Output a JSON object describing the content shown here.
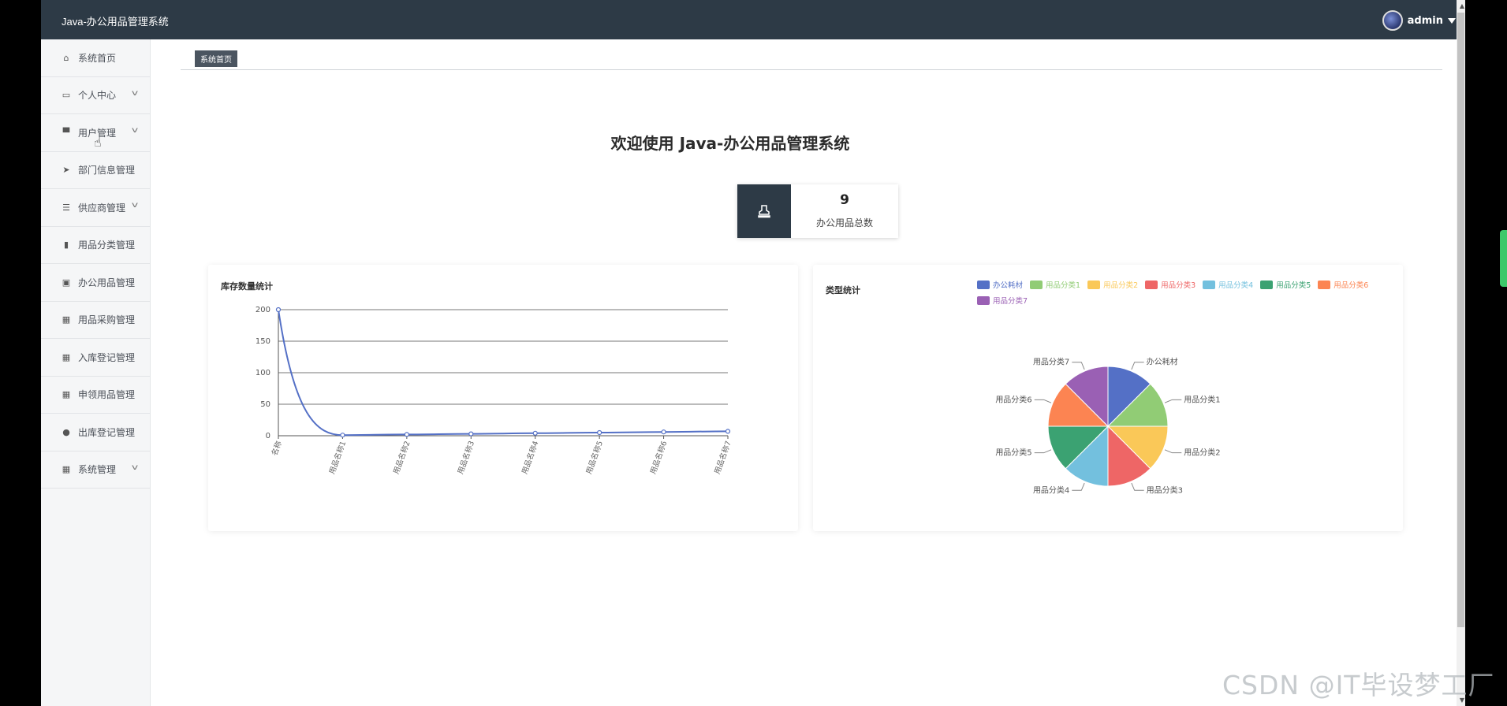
{
  "header": {
    "app_title": "Java-办公用品管理系统",
    "username": "admin"
  },
  "sidebar": {
    "items": [
      {
        "label": "系统首页",
        "icon": "home-icon",
        "has_submenu": false
      },
      {
        "label": "个人中心",
        "icon": "calendar-icon",
        "has_submenu": true
      },
      {
        "label": "用户管理",
        "icon": "user-icon",
        "has_submenu": true
      },
      {
        "label": "部门信息管理",
        "icon": "send-icon",
        "has_submenu": false
      },
      {
        "label": "供应商管理",
        "icon": "sliders-icon",
        "has_submenu": true
      },
      {
        "label": "用品分类管理",
        "icon": "bar-chart-icon",
        "has_submenu": false
      },
      {
        "label": "办公用品管理",
        "icon": "clipboard-icon",
        "has_submenu": false
      },
      {
        "label": "用品采购管理",
        "icon": "grid-icon",
        "has_submenu": false
      },
      {
        "label": "入库登记管理",
        "icon": "grid-icon",
        "has_submenu": false
      },
      {
        "label": "申领用品管理",
        "icon": "grid-icon",
        "has_submenu": false
      },
      {
        "label": "出库登记管理",
        "icon": "location-icon",
        "has_submenu": false
      },
      {
        "label": "系统管理",
        "icon": "grid-icon",
        "has_submenu": true
      }
    ]
  },
  "breadcrumb": {
    "current": "系统首页"
  },
  "welcome": "欢迎使用 Java-办公用品管理系统",
  "stat": {
    "value": "9",
    "label": "办公用品总数",
    "icon": "stamp-icon"
  },
  "colors": {
    "topbar": "#2d3a46",
    "line": "#5470c6"
  },
  "chart_data": [
    {
      "type": "line",
      "title": "库存数量统计",
      "categories": [
        "名称",
        "用品名称1",
        "用品名称2",
        "用品名称3",
        "用品名称4",
        "用品名称5",
        "用品名称6",
        "用品名称7"
      ],
      "values": [
        200,
        1,
        2,
        3,
        4,
        5,
        6,
        7
      ],
      "ylim": [
        0,
        200
      ],
      "yticks": [
        0,
        50,
        100,
        150,
        200
      ],
      "smooth": true,
      "grid": "horizontal"
    },
    {
      "type": "pie",
      "title": "类型统计",
      "legend_position": "top-right",
      "slices": [
        {
          "name": "办公耗材",
          "value": 1,
          "color": "#5470c6"
        },
        {
          "name": "用品分类1",
          "value": 1,
          "color": "#91cc75"
        },
        {
          "name": "用品分类2",
          "value": 1,
          "color": "#fac858"
        },
        {
          "name": "用品分类3",
          "value": 1,
          "color": "#ee6666"
        },
        {
          "name": "用品分类4",
          "value": 1,
          "color": "#73c0de"
        },
        {
          "name": "用品分类5",
          "value": 1,
          "color": "#3ba272"
        },
        {
          "name": "用品分类6",
          "value": 1,
          "color": "#fc8452"
        },
        {
          "name": "用品分类7",
          "value": 1,
          "color": "#9a60b4"
        }
      ]
    }
  ],
  "watermark": "CSDN @IT毕设梦工厂"
}
